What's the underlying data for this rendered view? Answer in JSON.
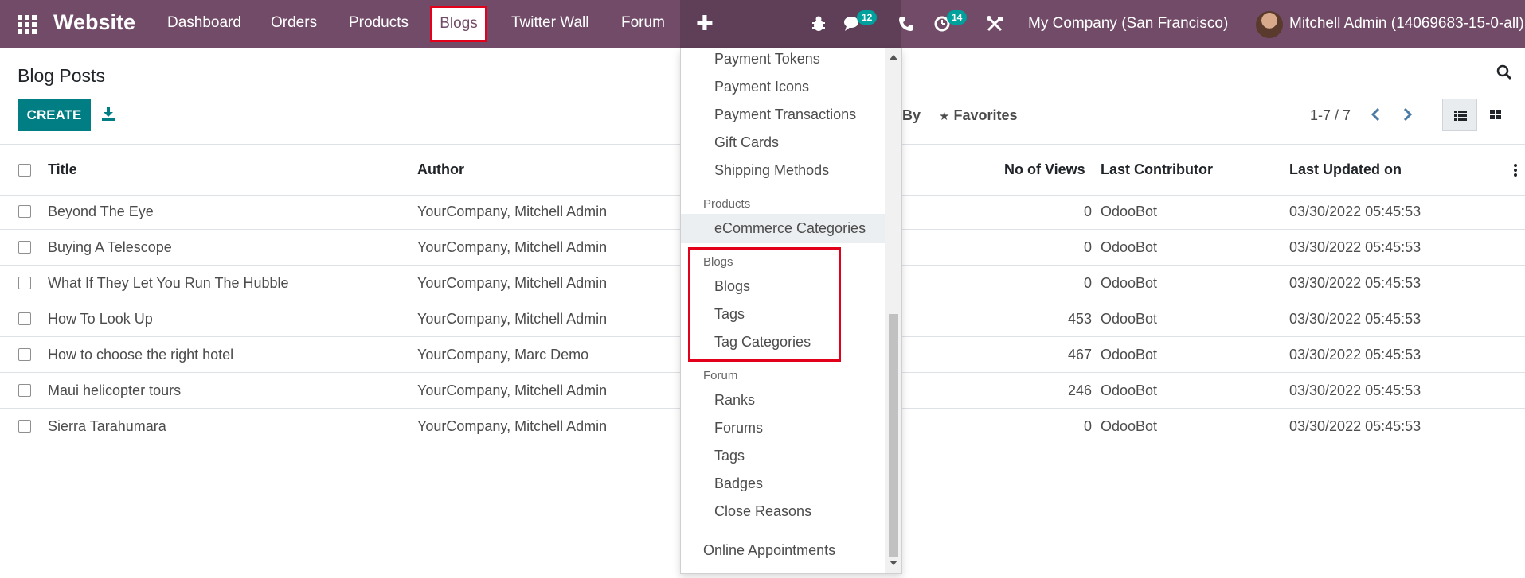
{
  "navbar": {
    "app_name": "Website",
    "menu": [
      "Dashboard",
      "Orders",
      "Products",
      "Blogs",
      "Twitter Wall",
      "Forum"
    ],
    "plus_label": "✚",
    "messages_count": "12",
    "activities_count": "14",
    "company": "My Company (San Francisco)",
    "user": "Mitchell Admin (14069683-15-0-all)"
  },
  "control": {
    "title": "Blog Posts",
    "create_label": "CREATE",
    "groupby_label": "By",
    "favorites_label": "Favorites",
    "pager": "1-7 / 7"
  },
  "table": {
    "columns": [
      "Title",
      "Author",
      "No of Views",
      "Last Contributor",
      "Last Updated on"
    ],
    "rows": [
      {
        "title": "Beyond The Eye",
        "author": "YourCompany, Mitchell Admin",
        "views": "0",
        "contributor": "OdooBot",
        "updated": "03/30/2022 05:45:53"
      },
      {
        "title": "Buying A Telescope",
        "author": "YourCompany, Mitchell Admin",
        "views": "0",
        "contributor": "OdooBot",
        "updated": "03/30/2022 05:45:53"
      },
      {
        "title": "What If They Let You Run The Hubble",
        "author": "YourCompany, Mitchell Admin",
        "views": "0",
        "contributor": "OdooBot",
        "updated": "03/30/2022 05:45:53"
      },
      {
        "title": "How To Look Up",
        "author": "YourCompany, Mitchell Admin",
        "views": "453",
        "contributor": "OdooBot",
        "updated": "03/30/2022 05:45:53"
      },
      {
        "title": "How to choose the right hotel",
        "author": "YourCompany, Marc Demo",
        "views": "467",
        "contributor": "OdooBot",
        "updated": "03/30/2022 05:45:53"
      },
      {
        "title": "Maui helicopter tours",
        "author": "YourCompany, Mitchell Admin",
        "views": "246",
        "contributor": "OdooBot",
        "updated": "03/30/2022 05:45:53"
      },
      {
        "title": "Sierra Tarahumara",
        "author": "YourCompany, Mitchell Admin",
        "views": "0",
        "contributor": "OdooBot",
        "updated": "03/30/2022 05:45:53"
      }
    ]
  },
  "dropdown": {
    "payment_items": [
      "Payment Tokens",
      "Payment Icons",
      "Payment Transactions",
      "Gift Cards",
      "Shipping Methods"
    ],
    "products_header": "Products",
    "products_items": [
      "eCommerce Categories"
    ],
    "blogs_header": "Blogs",
    "blogs_items": [
      "Blogs",
      "Tags",
      "Tag Categories"
    ],
    "forum_header": "Forum",
    "forum_items": [
      "Ranks",
      "Forums",
      "Tags",
      "Badges",
      "Close Reasons"
    ],
    "last_item": "Online Appointments"
  },
  "colors": {
    "navbar": "#714b67",
    "primary": "#017e84",
    "highlight": "#e2001a",
    "badge": "#00a09d"
  }
}
